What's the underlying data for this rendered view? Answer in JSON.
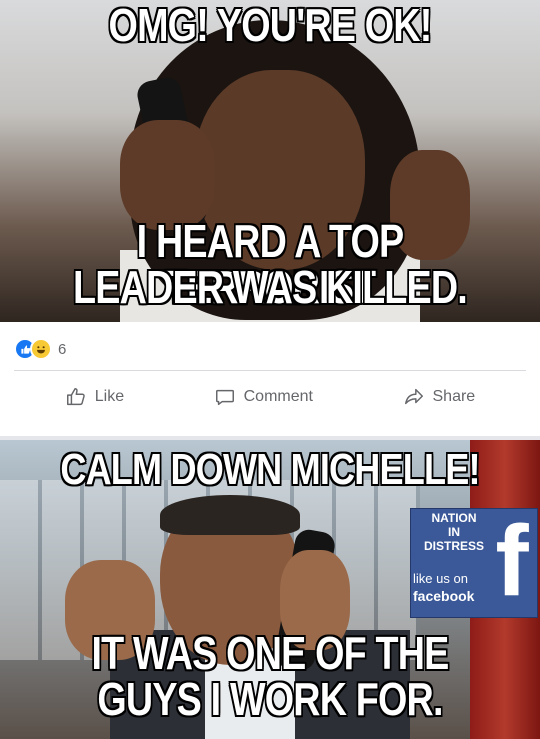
{
  "top_meme": {
    "caption_top": "OMG! YOU'RE OK!",
    "caption_bottom_line1": "I HEARD A TOP TERRORIST",
    "caption_bottom_line2": "LEADER WAS KILLED."
  },
  "reactions": {
    "count": "6",
    "icons": [
      "like-reaction-icon",
      "haha-reaction-icon"
    ]
  },
  "actions": {
    "like_label": "Like",
    "comment_label": "Comment",
    "share_label": "Share"
  },
  "bottom_meme": {
    "caption_top": "CALM DOWN MICHELLE!",
    "caption_bottom_line1": "IT WAS ONE OF THE",
    "caption_bottom_line2": "GUYS I WORK FOR.",
    "badge": {
      "line1": "NATION",
      "line2": "IN",
      "line3": "DISTRESS",
      "like_text": "like us on",
      "fb_text": "facebook",
      "f_glyph": "f"
    }
  },
  "colors": {
    "facebook_blue": "#1877f2",
    "badge_blue": "#3b5998",
    "action_gray": "#65676b"
  }
}
